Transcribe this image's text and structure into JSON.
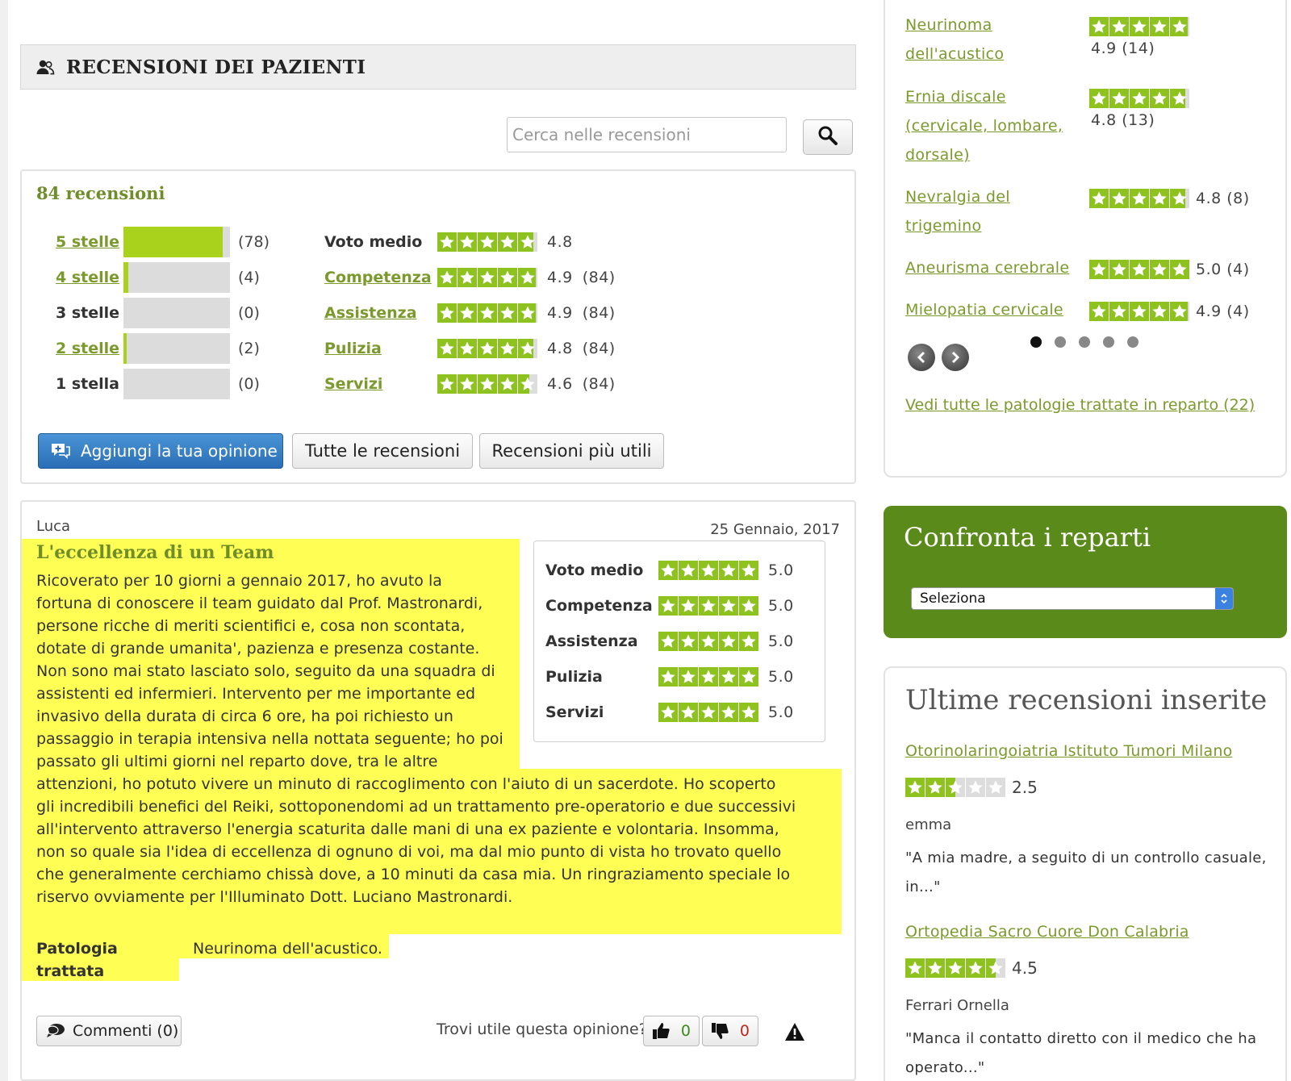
{
  "section_title": "RECENSIONI DEI PAZIENTI",
  "search": {
    "placeholder": "Cerca nelle recensioni"
  },
  "summary": {
    "count_label": "84 recensioni",
    "distribution": [
      {
        "label": "5 stelle",
        "count": "(78)",
        "value": 78,
        "link": true
      },
      {
        "label": "4 stelle",
        "count": "(4)",
        "value": 4,
        "link": true
      },
      {
        "label": "3 stelle",
        "count": "(0)",
        "value": 0,
        "link": false
      },
      {
        "label": "2 stelle",
        "count": "(2)",
        "value": 2,
        "link": true
      },
      {
        "label": "1 stella",
        "count": "(0)",
        "value": 0,
        "link": false
      }
    ],
    "ratings": [
      {
        "label": "Voto medio",
        "value": "4.8",
        "count": "",
        "score": 4.8,
        "link": false
      },
      {
        "label": "Competenza",
        "value": "4.9",
        "count": "(84)",
        "score": 4.9,
        "link": true
      },
      {
        "label": "Assistenza",
        "value": "4.9",
        "count": "(84)",
        "score": 4.9,
        "link": true
      },
      {
        "label": "Pulizia",
        "value": "4.8",
        "count": "(84)",
        "score": 4.8,
        "link": true
      },
      {
        "label": "Servizi",
        "value": "4.6",
        "count": "(84)",
        "score": 4.6,
        "link": true
      }
    ],
    "buttons": {
      "add": "Aggiungi la tua opinione",
      "all": "Tutte le recensioni",
      "useful": "Recensioni più utili"
    }
  },
  "review": {
    "author": "Luca",
    "date": "25 Gennaio, 2017",
    "title": "L'eccellenza di un Team",
    "body_lines": [
      "Ricoverato per 10 giorni a gennaio 2017, ho avuto la",
      "fortuna di conoscere il team guidato dal Prof. Mastronardi,",
      "persone ricche di meriti scientifici e, cosa non scontata,",
      "dotate di grande umanita', pazienza e presenza costante.",
      "Non sono mai stato lasciato solo, seguito da una squadra di",
      "assistenti ed infermieri. Intervento per me importante ed",
      "invasivo della durata di circa 6 ore, ha poi richiesto un",
      "passaggio in terapia intensiva nella nottata seguente; ho poi",
      "passato gli ultimi giorni nel reparto dove, tra le altre",
      "attenzioni, ho potuto vivere un minuto di raccoglimento con l'aiuto di un sacerdote. Ho scoperto",
      "gli incredibili benefici del Reiki, sottoponendomi ad un trattamento pre-operatorio e due successivi",
      "all'intervento attraverso l'energia scaturita dalle mani di una ex paziente e volontaria. Insomma,",
      "non so quale sia l'idea di eccellenza di ognuno di voi, ma dal mio punto di vista ho trovato quello",
      "che generalmente cerchiamo chissà dove, a 10 minuti da casa mia. Un ringraziamento speciale lo",
      "riservo ovviamente per l'Illuminato Dott. Luciano Mastronardi."
    ],
    "ratings": [
      {
        "label": "Voto medio",
        "value": "5.0",
        "score": 5
      },
      {
        "label": "Competenza",
        "value": "5.0",
        "score": 5
      },
      {
        "label": "Assistenza",
        "value": "5.0",
        "score": 5
      },
      {
        "label": "Pulizia",
        "value": "5.0",
        "score": 5
      },
      {
        "label": "Servizi",
        "value": "5.0",
        "score": 5
      }
    ],
    "pathology_label_1": "Patologia",
    "pathology_label_2": "trattata",
    "pathology_value": "Neurinoma dell'acustico.",
    "comments_label": "Commenti (0)",
    "useful_question": "Trovi utile questa opinione?",
    "thumbs_up": "0",
    "thumbs_down": "0"
  },
  "pathologies": [
    {
      "name_lines": [
        "Neurinoma",
        "dell'acustico"
      ],
      "score": 4.9,
      "rating_text": "4.9 (14)",
      "inline": false
    },
    {
      "name_lines": [
        "Ernia discale",
        "(cervicale, lombare,",
        "dorsale)"
      ],
      "score": 4.8,
      "rating_text": "4.8 (13)",
      "inline": false
    },
    {
      "name_lines": [
        "Nevralgia del",
        "trigemino"
      ],
      "score": 4.8,
      "rating_text": "4.8 (8)",
      "inline": true
    },
    {
      "name_lines": [
        "Aneurisma cerebrale"
      ],
      "score": 5.0,
      "rating_text": "5.0 (4)",
      "inline": true
    },
    {
      "name_lines": [
        "Mielopatia cervicale"
      ],
      "score": 4.9,
      "rating_text": "4.9 (4)",
      "inline": true
    }
  ],
  "carousel": {
    "pages": 5,
    "active": 0
  },
  "all_pathologies_link": "Vedi tutte le patologie trattate in reparto (22)",
  "compare": {
    "title": "Confronta i reparti",
    "select_value": "Seleziona"
  },
  "latest": {
    "title": "Ultime recensioni inserite",
    "items": [
      {
        "link": "Otorinolaringoiatria Istituto Tumori Milano",
        "score": 2.5,
        "value": "2.5",
        "author": "emma",
        "quote": "\"A mia madre, a seguito di un controllo casuale, in...\""
      },
      {
        "link": "Ortopedia Sacro Cuore Don Calabria",
        "score": 4.5,
        "value": "4.5",
        "author": "Ferrari Ornella",
        "quote": "\"Manca il contatto diretto con il medico che ha operato...\""
      }
    ]
  },
  "colors": {
    "accent_green": "#7b9a2c",
    "bar_fill": "#a8d21c",
    "star_green": "#8dc21f",
    "highlight": "#fefe55",
    "compare_bg": "#5a8a1a",
    "button_blue": "#2a6fb6"
  }
}
